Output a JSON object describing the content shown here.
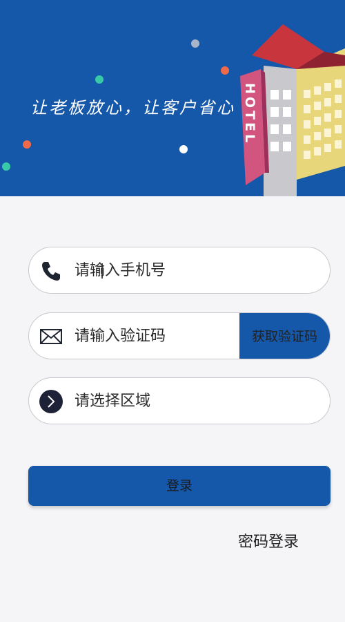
{
  "banner": {
    "slogan": "让老板放心，让客户省心",
    "hotel_sign": "HOTEL",
    "background_color": "#1557a8"
  },
  "form": {
    "phone": {
      "placeholder": "请输入手机号",
      "icon": "phone-icon"
    },
    "code": {
      "placeholder": "请输入验证码",
      "icon": "envelope-icon",
      "button_label": "获取验证码"
    },
    "region": {
      "placeholder": "请选择区域",
      "icon": "chevron-right-circle-icon"
    }
  },
  "actions": {
    "login_label": "登录",
    "password_login_label": "密码登录"
  },
  "colors": {
    "accent": "#1557a8",
    "page_background": "#f5f5f7",
    "field_border": "#c7c7cc"
  }
}
